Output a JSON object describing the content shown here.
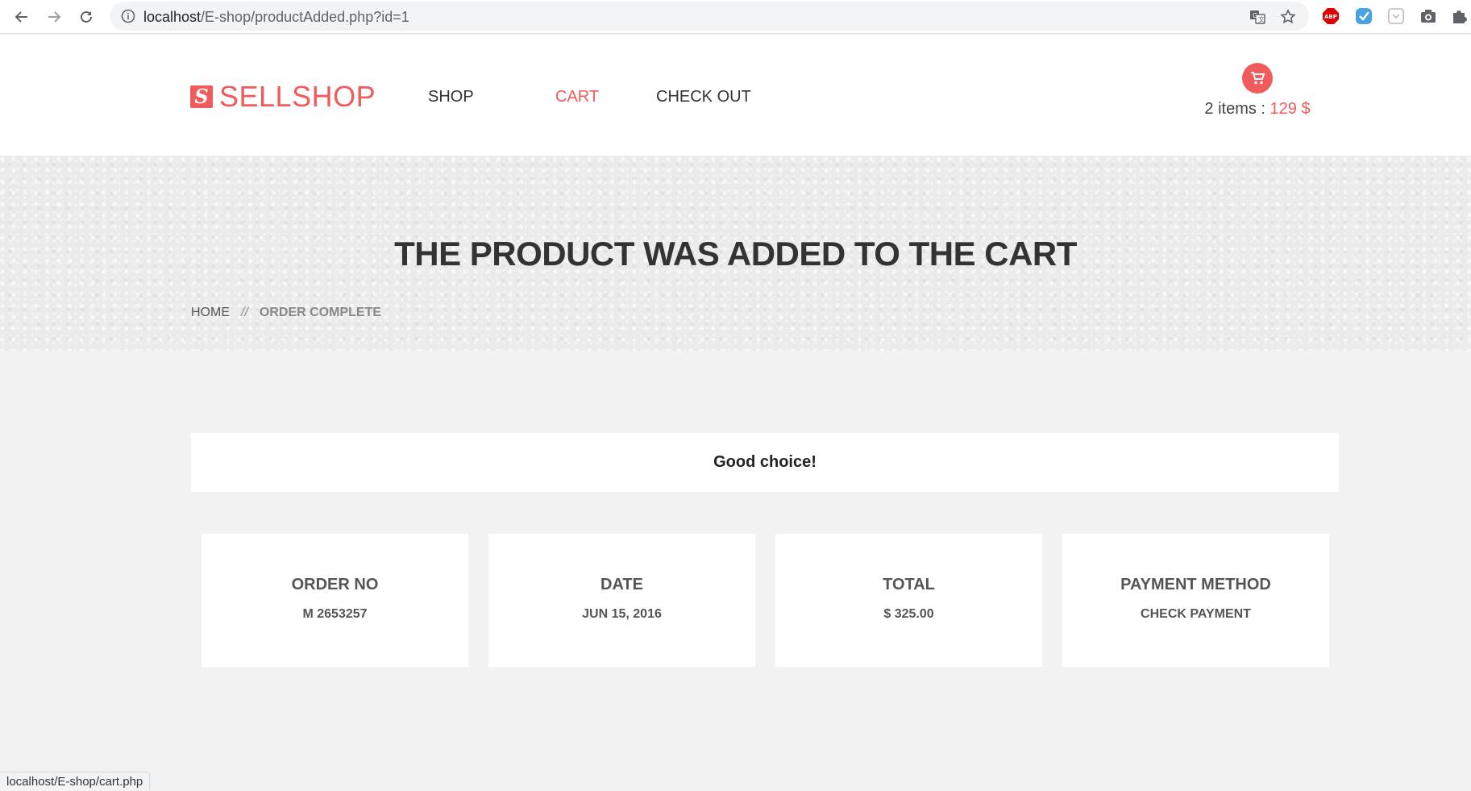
{
  "browser": {
    "url_host": "localhost",
    "url_path": "/E-shop/productAdded.php?id=1",
    "status_url": "localhost/E-shop/cart.php"
  },
  "header": {
    "logo_mark": "S",
    "logo_text": "SELLSHOP",
    "menu": [
      {
        "label": "SHOP"
      },
      {
        "label": "CART"
      },
      {
        "label": "CHECK OUT"
      }
    ],
    "cart": {
      "items": "2 items : ",
      "amount": "129 $"
    }
  },
  "banner": {
    "title": "THE PRODUCT WAS ADDED TO THE CART",
    "breadcrumb": {
      "home": "HOME",
      "separator": "//",
      "current": "ORDER COMPLETE"
    }
  },
  "main": {
    "message": "Good choice!",
    "cards": [
      {
        "label": "ORDER NO",
        "value": "M 2653257"
      },
      {
        "label": "DATE",
        "value": "JUN 15, 2016"
      },
      {
        "label": "TOTAL",
        "value": "$ 325.00"
      },
      {
        "label": "PAYMENT METHOD",
        "value": "CHECK PAYMENT"
      }
    ]
  },
  "colors": {
    "accent": "#f15b5b",
    "text": "#333333",
    "page_bg": "#f2f2f2"
  },
  "icons": [
    "back-arrow-icon",
    "forward-arrow-icon",
    "reload-icon",
    "info-icon",
    "translate-icon",
    "star-icon",
    "adblock-icon",
    "extension-check-icon",
    "extension-pocket-icon",
    "camera-icon",
    "puzzle-icon",
    "cart-icon"
  ]
}
